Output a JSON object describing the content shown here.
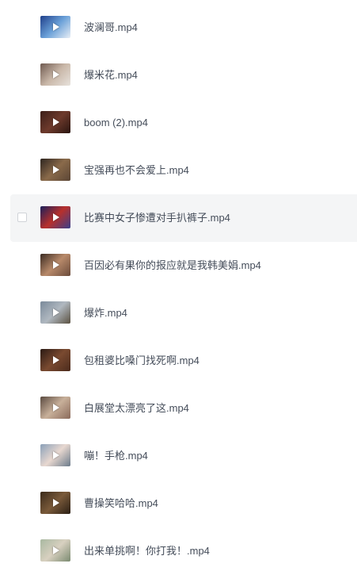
{
  "files": [
    {
      "name": "波澜哥.mp4",
      "thumb_colors": [
        "#1f3f8a",
        "#6aa0d8",
        "#e8eef5"
      ],
      "icon": "video-thumbnail-icon",
      "hovered": false
    },
    {
      "name": "爆米花.mp4",
      "thumb_colors": [
        "#6f5a50",
        "#c9b7a8",
        "#e7e2dc"
      ],
      "icon": "video-thumbnail-icon",
      "hovered": false
    },
    {
      "name": "boom (2).mp4",
      "thumb_colors": [
        "#3b1e18",
        "#6e3a2c",
        "#2a1510"
      ],
      "icon": "video-thumbnail-icon",
      "hovered": false
    },
    {
      "name": "宝强再也不会爱上.mp4",
      "thumb_colors": [
        "#2d2520",
        "#8a6a4a",
        "#5a4535"
      ],
      "icon": "video-thumbnail-icon",
      "hovered": false
    },
    {
      "name": "比赛中女子惨遭对手扒裤子.mp4",
      "thumb_colors": [
        "#1a1f5a",
        "#b8302c",
        "#3a3f8a"
      ],
      "icon": "video-thumbnail-icon",
      "hovered": true
    },
    {
      "name": "百因必有果你的报应就是我韩美娟.mp4",
      "thumb_colors": [
        "#3a2a22",
        "#b88a6a",
        "#6a4a3a"
      ],
      "icon": "video-thumbnail-icon",
      "hovered": false
    },
    {
      "name": "爆炸.mp4",
      "thumb_colors": [
        "#7a8a9a",
        "#b0b8c0",
        "#5a5040"
      ],
      "icon": "video-thumbnail-icon",
      "hovered": false
    },
    {
      "name": "包租婆比嗓门找死啊.mp4",
      "thumb_colors": [
        "#2a1a14",
        "#7a4a30",
        "#4a2a1c"
      ],
      "icon": "video-thumbnail-icon",
      "hovered": false
    },
    {
      "name": "白展堂太漂亮了这.mp4",
      "thumb_colors": [
        "#5a4a40",
        "#c8b09a",
        "#8a6a5a"
      ],
      "icon": "video-thumbnail-icon",
      "hovered": false
    },
    {
      "name": "嘣！手枪.mp4",
      "thumb_colors": [
        "#8aa0b8",
        "#e8d8d0",
        "#6a7a8a"
      ],
      "icon": "video-thumbnail-icon",
      "hovered": false
    },
    {
      "name": "曹操笑哈哈.mp4",
      "thumb_colors": [
        "#3a2a1a",
        "#7a5a3a",
        "#2a1e14"
      ],
      "icon": "video-thumbnail-icon",
      "hovered": false
    },
    {
      "name": "出来单挑啊！你打我！.mp4",
      "thumb_colors": [
        "#a8b8a0",
        "#d8d0c0",
        "#7a8a70"
      ],
      "icon": "video-thumbnail-icon",
      "hovered": false
    }
  ]
}
